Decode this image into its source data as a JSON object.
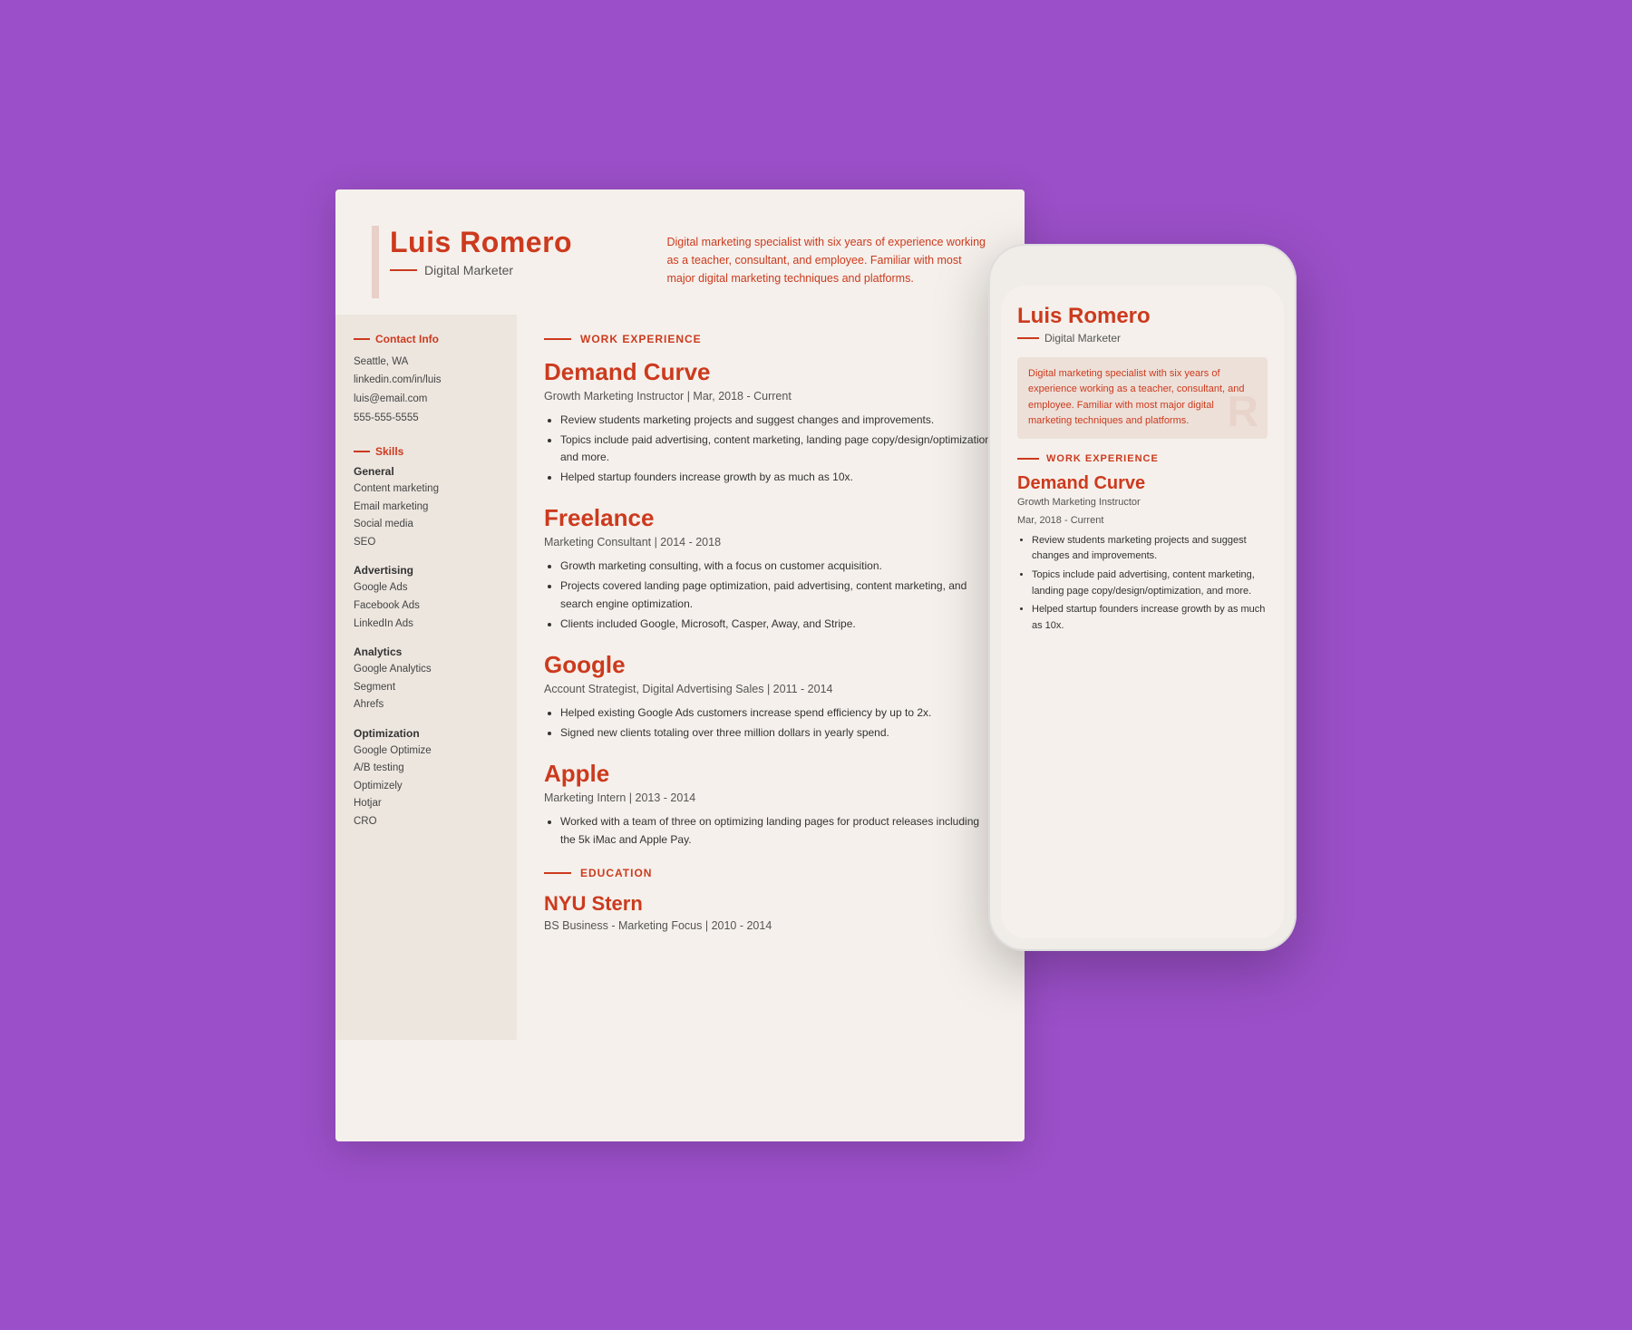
{
  "resume": {
    "name": "Luis Romero",
    "title": "Digital Marketer",
    "summary": "Digital marketing specialist with six years of experience working as a teacher, consultant, and employee. Familiar with most major digital marketing techniques and platforms.",
    "contact": {
      "label": "Contact Info",
      "items": [
        "Seattle, WA",
        "linkedin.com/in/luis",
        "luis@email.com",
        "555-555-5555"
      ]
    },
    "skills": {
      "label": "Skills",
      "groups": [
        {
          "title": "General",
          "items": [
            "Content marketing",
            "Email marketing",
            "Social media",
            "SEO"
          ]
        },
        {
          "title": "Advertising",
          "items": [
            "Google Ads",
            "Facebook Ads",
            "LinkedIn Ads"
          ]
        },
        {
          "title": "Analytics",
          "items": [
            "Google Analytics",
            "Segment",
            "Ahrefs"
          ]
        },
        {
          "title": "Optimization",
          "items": [
            "Google Optimize",
            "A/B testing",
            "Optimizely",
            "Hotjar",
            "CRO"
          ]
        }
      ]
    },
    "work_experience_label": "Work Experience",
    "jobs": [
      {
        "company": "Demand Curve",
        "role": "Growth Marketing Instructor | Mar, 2018 - Current",
        "bullets": [
          "Review students marketing projects and suggest changes and improvements.",
          "Topics include paid advertising, content marketing, landing page copy/design/optimization, and more.",
          "Helped startup founders increase growth by as much as 10x."
        ]
      },
      {
        "company": "Freelance",
        "role": "Marketing Consultant | 2014 - 2018",
        "bullets": [
          "Growth marketing consulting, with a focus on customer acquisition.",
          "Projects covered landing page optimization, paid advertising, content marketing, and search engine optimization.",
          "Clients included Google, Microsoft, Casper, Away, and Stripe."
        ]
      },
      {
        "company": "Google",
        "role": "Account Strategist, Digital Advertising Sales | 2011 - 2014",
        "bullets": [
          "Helped existing Google Ads customers increase spend efficiency by up to 2x.",
          "Signed new clients totaling over three million dollars in yearly spend."
        ]
      },
      {
        "company": "Apple",
        "role": "Marketing Intern | 2013 - 2014",
        "bullets": [
          "Worked with a team of three on optimizing landing pages for product releases including the 5k iMac and Apple Pay."
        ]
      }
    ],
    "education_label": "Education",
    "education": {
      "school": "NYU Stern",
      "degree": "BS Business - Marketing Focus | 2010 - 2014"
    }
  },
  "phone": {
    "name": "Luis Romero",
    "title": "Digital Marketer",
    "summary": "Digital marketing specialist with six years of experience working as a teacher, consultant, and employee. Familiar with most major digital marketing techniques and platforms.",
    "work_experience_label": "Work Experience",
    "job": {
      "company": "Demand Curve",
      "role_line1": "Growth Marketing Instructor",
      "role_line2": "Mar, 2018 - Current",
      "bullets": [
        "Review students marketing projects and suggest changes and improvements.",
        "Topics include paid advertising, content marketing, landing page copy/design/optimization, and more.",
        "Helped startup founders increase growth by as much as 10x."
      ]
    }
  }
}
